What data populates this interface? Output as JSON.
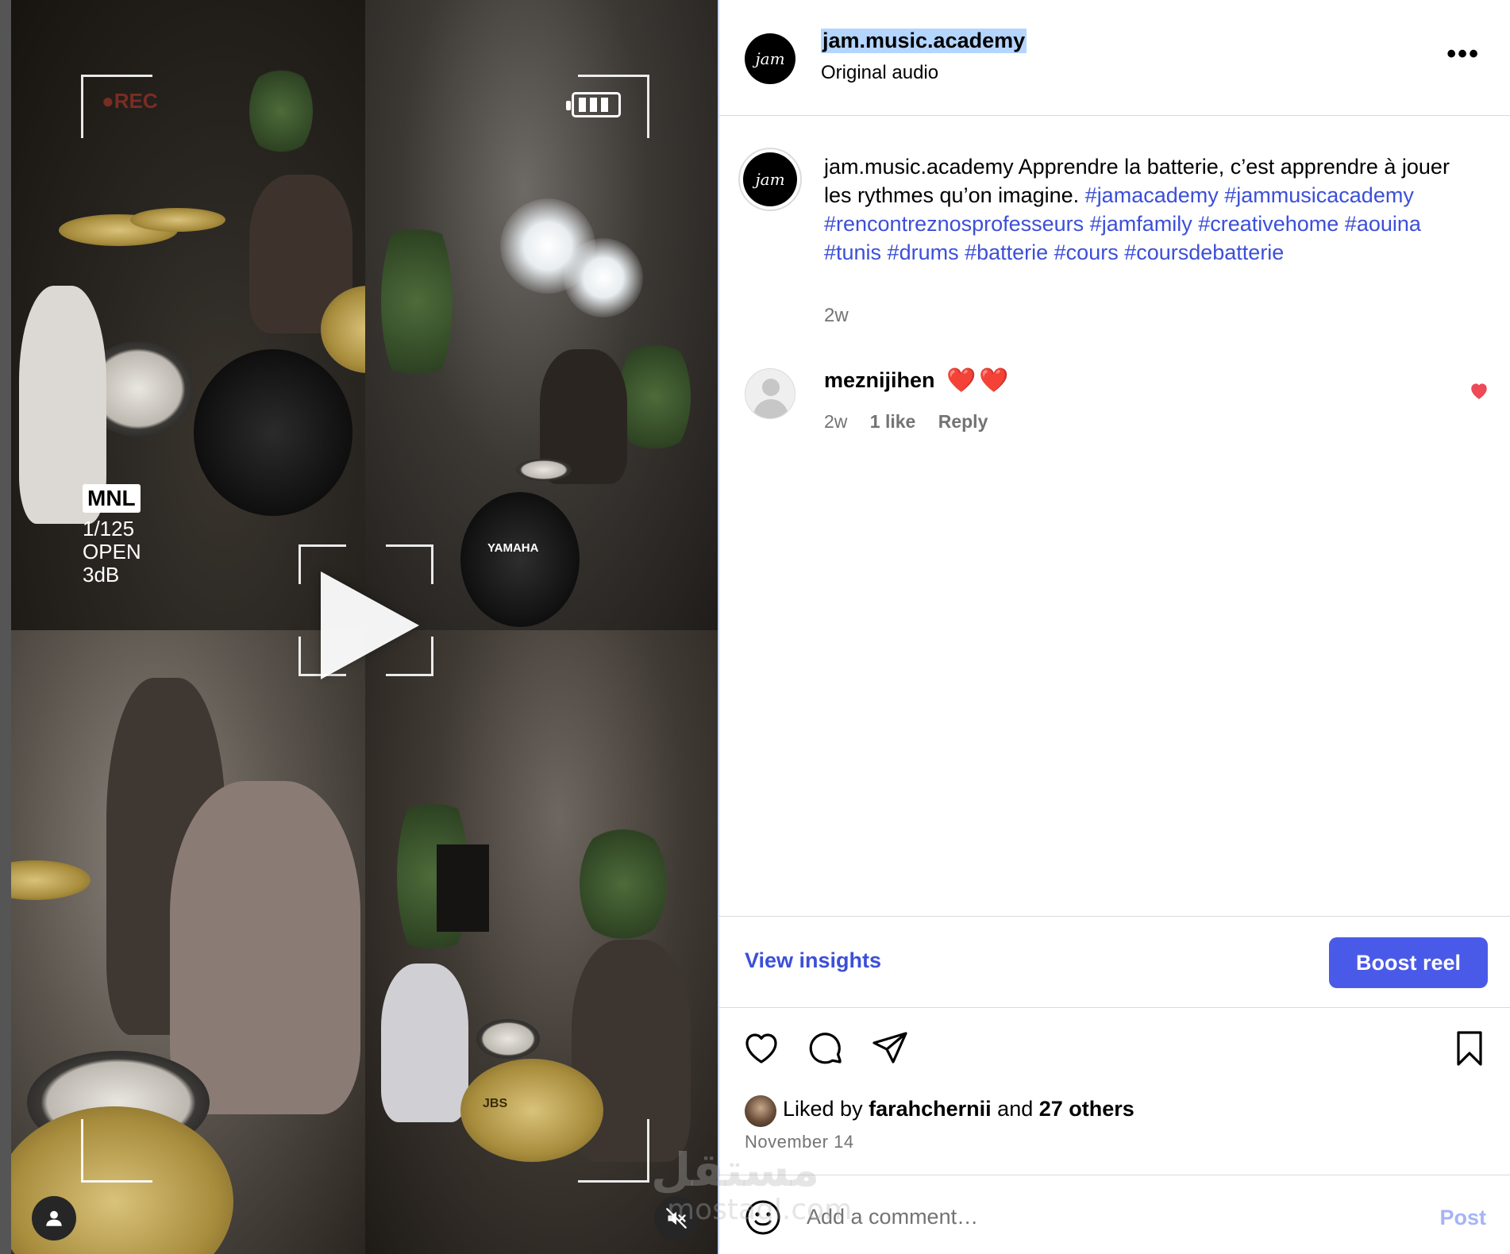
{
  "media": {
    "overlay": {
      "rec_label": "●REC",
      "mode_badge": "MNL",
      "shutter": "1/125",
      "aperture": "OPEN",
      "gain": "3dB"
    },
    "bass_drum_brand": "YAMAHA",
    "cymbal_brand": "JBS"
  },
  "header": {
    "username": "jam.music.academy",
    "subtitle": "Original audio",
    "more_label": "•••"
  },
  "logo_text": "jam",
  "caption": {
    "username": "jam.music.academy",
    "text": "Apprendre la batterie, c’est apprendre à jouer les rythmes qu’on imagine.",
    "hashtags": "#jamacademy #jammusicacademy #rencontreznosprofesseurs #jamfamily #creativehome #aouina #tunis #drums #batterie #cours #coursdebatterie",
    "time": "2w"
  },
  "comment": {
    "username": "meznijihen",
    "text": "❤️❤️",
    "time": "2w",
    "likes": "1 like",
    "reply_label": "Reply"
  },
  "insights": {
    "view_label": "View insights",
    "boost_label": "Boost reel"
  },
  "likes": {
    "prefix": "Liked by",
    "user": "farahchernii",
    "middle": "and",
    "others": "27 others"
  },
  "date": "November 14",
  "comment_box": {
    "placeholder": "Add a comment…",
    "post_label": "Post"
  },
  "watermark": {
    "arabic": "مستقل",
    "latin": "mostaql.com"
  },
  "colors": {
    "link_blue": "#3c4fd8",
    "boost_button": "#4a5ae8",
    "post_disabled": "#a5b3f7",
    "heart_red": "#ed4956",
    "muted_gray": "#737373"
  }
}
